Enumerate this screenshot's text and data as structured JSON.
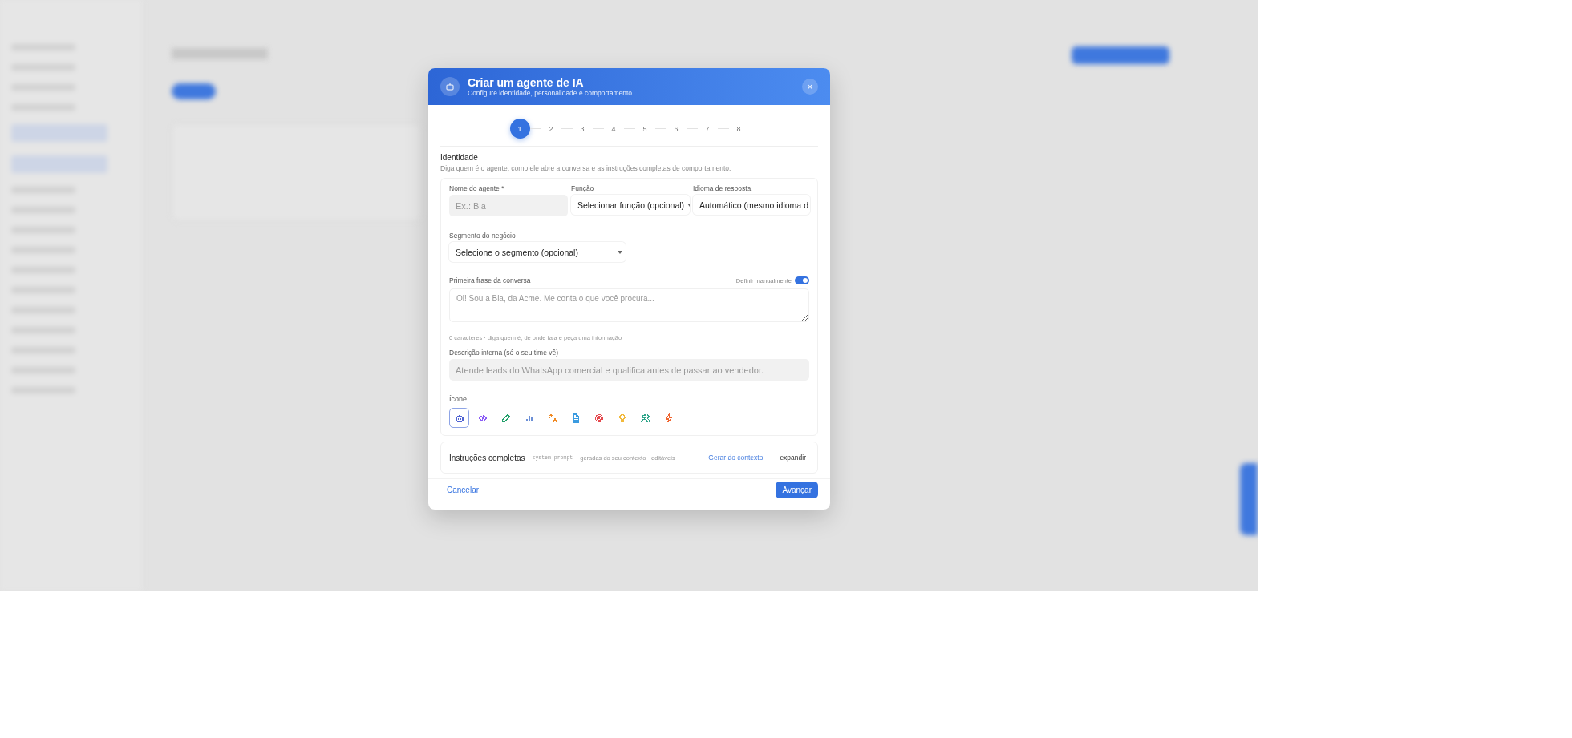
{
  "modal": {
    "title": "Criar um agente de IA",
    "subtitle": "Configure identidade, personalidade e comportamento",
    "close": "×",
    "steps": [
      {
        "label": "1",
        "selected": true
      },
      {
        "label": "2",
        "selected": false
      },
      {
        "label": "3",
        "selected": false
      },
      {
        "label": "4",
        "selected": false
      },
      {
        "label": "5",
        "selected": false
      },
      {
        "label": "6",
        "selected": false
      },
      {
        "label": "7",
        "selected": false
      },
      {
        "label": "8",
        "selected": false
      }
    ],
    "section": {
      "title": "Identidade",
      "description": "Diga quem é o agente, como ele abre a conversa e as instruções completas de comportamento."
    },
    "fields": [
      {
        "label": "Nome do agente *",
        "kind": "input",
        "placeholder": "Ex.: Bia"
      },
      {
        "label": "Função",
        "kind": "select",
        "value": "Selecionar função (opcional)"
      },
      {
        "label": "Idioma de resposta",
        "kind": "select",
        "value": "Automático (mesmo idioma d"
      }
    ],
    "segment": {
      "label": "Segmento do negócio",
      "value": "Selecione o segmento (opcional)"
    },
    "first_phrase": {
      "label": "Primeira frase da conversa",
      "toggle_label": "Definir manualmente",
      "toggle_on": true,
      "placeholder": "Oi! Sou a Bia, da Acme. Me conta o que você procura...",
      "hint": "0 caracteres · diga quem é, de onde fala e peça uma informação"
    },
    "description": {
      "label": "Descrição interna (só o seu time vê)",
      "placeholder": "Atende leads do WhatsApp comercial e qualifica antes de passar ao vendedor."
    },
    "icon_label": "Ícone",
    "icons": [
      {
        "kind": "robot",
        "color": "#4f63d2",
        "selected": true
      },
      {
        "kind": "code",
        "color": "#8b5cf6",
        "selected": false
      },
      {
        "kind": "pencil",
        "color": "#22a06b",
        "selected": false
      },
      {
        "kind": "bars",
        "color": "#6b8fd6",
        "selected": false
      },
      {
        "kind": "translate",
        "color": "#f08a24",
        "selected": false
      },
      {
        "kind": "document",
        "color": "#3b9be0",
        "selected": false
      },
      {
        "kind": "target",
        "color": "#e5484d",
        "selected": false
      },
      {
        "kind": "bulb",
        "color": "#f2b93b",
        "selected": false
      },
      {
        "kind": "users",
        "color": "#2fa58a",
        "selected": false
      },
      {
        "kind": "zap",
        "color": "#f0652f",
        "selected": false
      }
    ],
    "instructions": {
      "title": "Instruções completas",
      "tag": "system prompt",
      "note": "geradas do seu contexto · editáveis",
      "generate": "Gerar do contexto",
      "expand": "expandir"
    },
    "cancel": "Cancelar",
    "next": "Avançar"
  }
}
